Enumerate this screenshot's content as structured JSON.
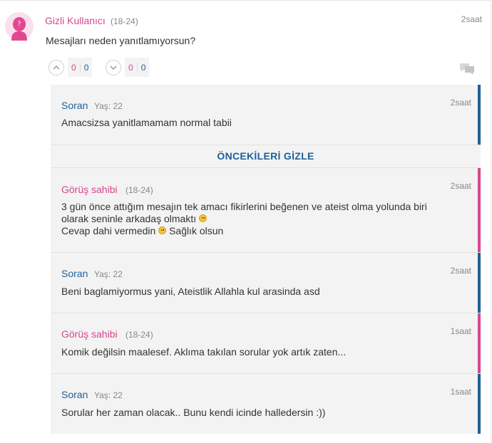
{
  "main_comment": {
    "username": "Gizli Kullanıcı",
    "age": "(18-24)",
    "time": "2saat",
    "text": "Mesajları neden yanıtlamıyorsun?",
    "upvote": {
      "pink": "0",
      "blue": "0"
    },
    "downvote": {
      "pink": "0",
      "blue": "0"
    },
    "avatar_icon": "female-avatar-question-icon",
    "reply_icon": "reply-chat-icon"
  },
  "hide_label": "ÖNCEKİLERİ GİZLE",
  "replies": [
    {
      "username": "Soran",
      "age": "Yaş: 22",
      "time": "2saat",
      "text": "Amacsizsa yanitlamamam normal tabii",
      "color": "#1f5f99"
    },
    {
      "username": "Görüş sahibi",
      "age": "(18-24)",
      "time": "2saat",
      "line1": "3 gün önce attığım mesajın tek amacı fikirlerini beğenen ve ateist olma yolunda biri olarak seninle arkadaş olmaktı",
      "line2a": "Cevap dahi vermedin",
      "line2b": "Sağlık olsun",
      "color": "#d6478f",
      "emoji_icons": [
        "sad-emoji-icon",
        "smile-emoji-icon"
      ]
    },
    {
      "username": "Soran",
      "age": "Yaş: 22",
      "time": "2saat",
      "text": "Beni baglamiyormus yani, Ateistlik Allahla kul arasinda asd",
      "color": "#1f5f99"
    },
    {
      "username": "Görüş sahibi",
      "age": "(18-24)",
      "time": "1saat",
      "text": "Komik değilsin maalesef. Aklıma takılan sorular yok artık zaten...",
      "color": "#d6478f"
    },
    {
      "username": "Soran",
      "age": "Yaş: 22",
      "time": "1saat",
      "text": "Sorular her zaman olacak.. Bunu kendi icinde halledersin :))",
      "color": "#1f5f99"
    }
  ]
}
